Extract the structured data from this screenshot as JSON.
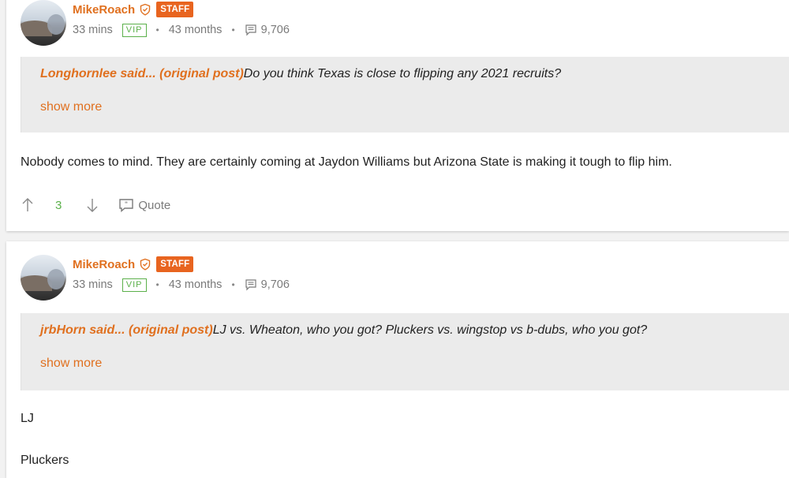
{
  "posts": [
    {
      "username": "MikeRoach",
      "badge": "STAFF",
      "time": "33 mins",
      "vip": "VIP",
      "tenure": "43 months",
      "post_count": "9,706",
      "quote": {
        "author": "Longhornlee said...",
        "open": " (",
        "link": "original post",
        "close": ")",
        "text": "Do you think Texas is close to flipping any 2021 recruits?",
        "show_more": "show more"
      },
      "body": [
        "Nobody comes to mind. They are certainly coming at Jaydon Williams but Arizona State is making it tough to flip him."
      ],
      "votes": "3",
      "quote_label": "Quote"
    },
    {
      "username": "MikeRoach",
      "badge": "STAFF",
      "time": "33 mins",
      "vip": "VIP",
      "tenure": "43 months",
      "post_count": "9,706",
      "quote": {
        "author": "jrbHorn said...",
        "open": " (",
        "link": "original post",
        "close": ")",
        "text": "LJ vs. Wheaton, who you got? Pluckers vs. wingstop vs b-dubs, who you got?",
        "show_more": "show more"
      },
      "body": [
        "LJ",
        "Pluckers"
      ]
    }
  ],
  "colors": {
    "accent": "#e0701f",
    "staff_badge": "#e8641f",
    "vip_green": "#5bb04a",
    "quote_bg": "#ebebeb"
  },
  "icons": [
    "verified-shield-icon",
    "posts-count-icon",
    "upvote-arrow-icon",
    "downvote-arrow-icon",
    "quote-bubble-icon"
  ]
}
